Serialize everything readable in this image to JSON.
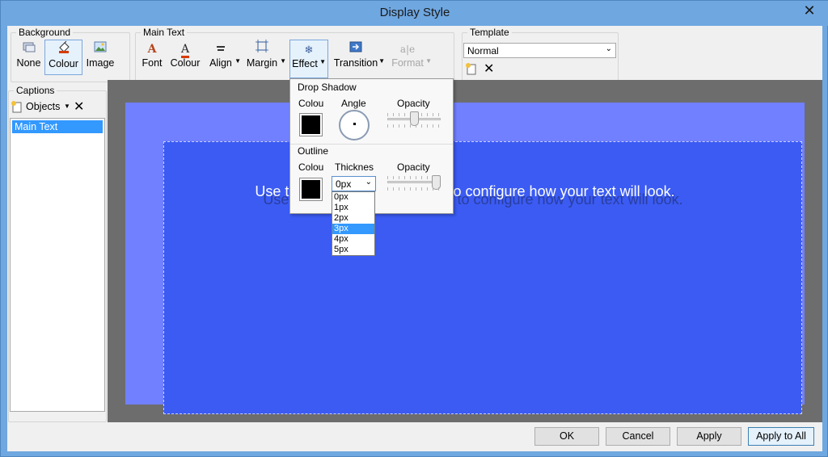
{
  "window": {
    "title": "Display Style",
    "close_glyph": "✕"
  },
  "background_group": {
    "label": "Background",
    "buttons": [
      {
        "label": "None",
        "icon": "none-icon"
      },
      {
        "label": "Colour",
        "icon": "paint-bucket-icon",
        "selected": true
      },
      {
        "label": "Image",
        "icon": "image-icon"
      }
    ]
  },
  "main_text_group": {
    "label": "Main Text",
    "buttons": [
      {
        "label": "Font",
        "icon": "font-icon"
      },
      {
        "label": "Colour",
        "icon": "text-colour-icon"
      },
      {
        "label": "Align",
        "icon": "align-icon",
        "dropdown": true
      },
      {
        "label": "Margin",
        "icon": "margin-icon",
        "dropdown": true
      },
      {
        "label": "Effect",
        "icon": "effect-icon",
        "dropdown": true,
        "selected": true
      },
      {
        "label": "Transition",
        "icon": "transition-icon",
        "dropdown": true
      },
      {
        "label": "Format",
        "icon": "format-icon",
        "dropdown": true,
        "disabled": true
      }
    ]
  },
  "template_group": {
    "label": "Template",
    "select_value": "Normal"
  },
  "captions_group": {
    "label": "Captions",
    "objects_label": "Objects",
    "items": [
      "Main Text"
    ],
    "selected_item": "Main Text"
  },
  "preview": {
    "text": "Use the buttons in the toolbar to configure how your text will look.",
    "colors": {
      "stage": "#6d6d6d",
      "outer": "#7180ff",
      "inner": "#3b5bf3"
    }
  },
  "effect_popup": {
    "drop_shadow": {
      "title": "Drop Shadow",
      "colour_label": "Colou",
      "angle_label": "Angle",
      "opacity_label": "Opacity",
      "colour": "#000000"
    },
    "outline": {
      "title": "Outline",
      "colour_label": "Colou",
      "thickness_label": "Thicknes",
      "opacity_label": "Opacity",
      "colour": "#000000",
      "thickness_value": "0px"
    }
  },
  "thickness_dropdown": {
    "options": [
      "0px",
      "1px",
      "2px",
      "3px",
      "4px",
      "5px"
    ],
    "highlighted": "3px"
  },
  "footer": {
    "ok": "OK",
    "cancel": "Cancel",
    "apply": "Apply",
    "apply_to_all": "Apply to All"
  }
}
